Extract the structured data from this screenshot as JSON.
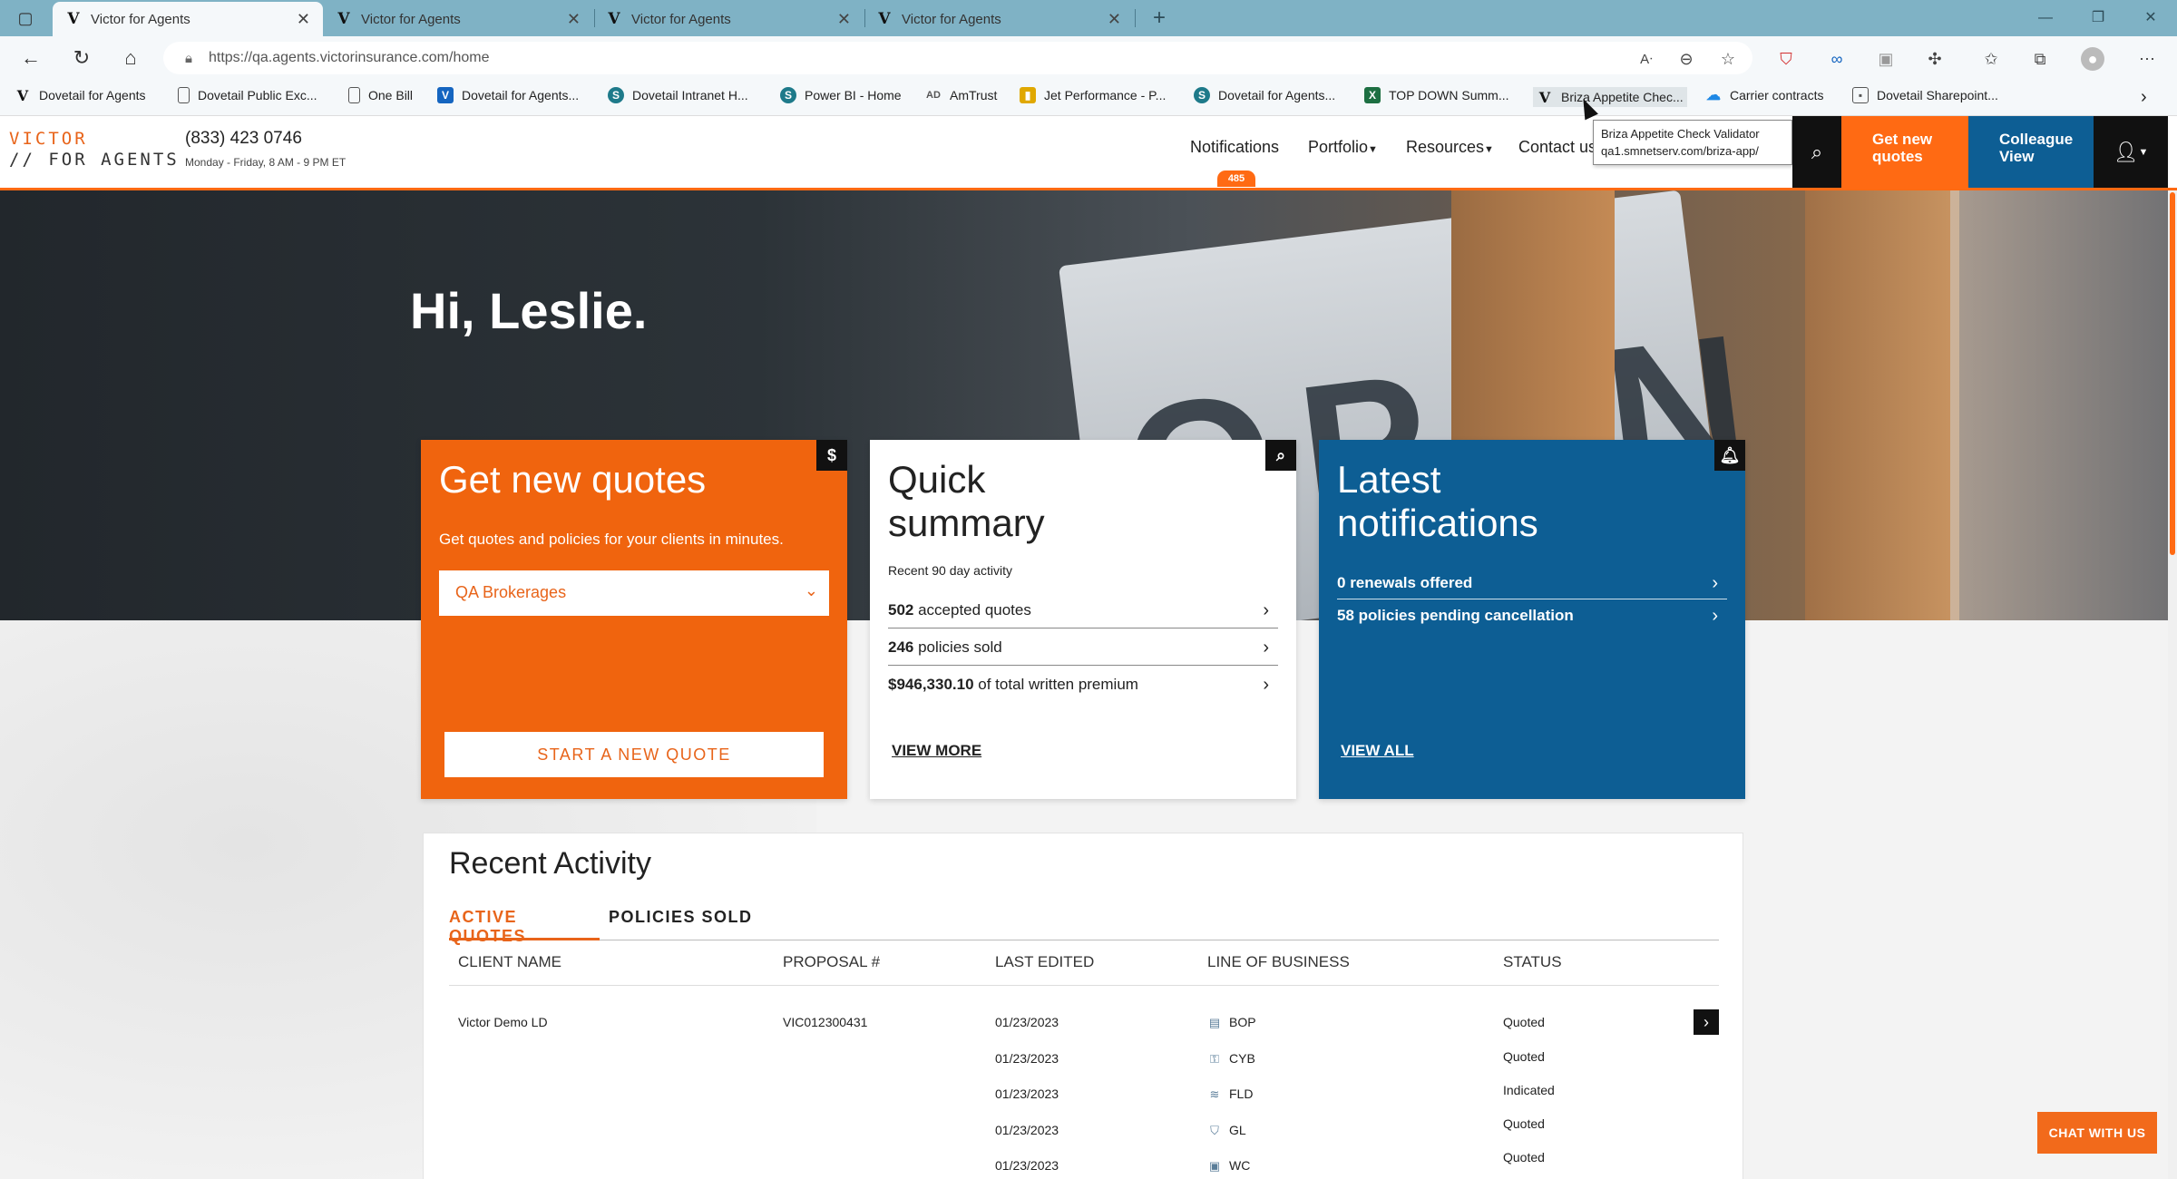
{
  "browser": {
    "tabs": [
      {
        "title": "Victor for Agents",
        "active": true
      },
      {
        "title": "Victor for Agents",
        "active": false
      },
      {
        "title": "Victor for Agents",
        "active": false
      },
      {
        "title": "Victor for Agents",
        "active": false
      }
    ],
    "url": "https://qa.agents.victorinsurance.com/home",
    "bookmarks": [
      {
        "label": "Dovetail for Agents",
        "icon": "victor-icon",
        "color": "#111111"
      },
      {
        "label": "Dovetail Public Exc...",
        "icon": "page-icon",
        "color": "#555555"
      },
      {
        "label": "One Bill",
        "icon": "page-icon",
        "color": "#555555"
      },
      {
        "label": "Dovetail for Agents...",
        "icon": "shield-v-icon",
        "color": "#1565c0"
      },
      {
        "label": "Dovetail Intranet H...",
        "icon": "sharepoint-icon",
        "color": "#1e7a8a"
      },
      {
        "label": "Power BI - Home",
        "icon": "sharepoint-icon",
        "color": "#1e7a8a"
      },
      {
        "label": "AmTrust",
        "icon": "amtrust-icon",
        "color": "#555555"
      },
      {
        "label": "Jet Performance - P...",
        "icon": "chart-icon",
        "color": "#e0a800"
      },
      {
        "label": "Dovetail for Agents...",
        "icon": "sharepoint-icon",
        "color": "#1e7a8a"
      },
      {
        "label": "TOP DOWN Summ...",
        "icon": "excel-icon",
        "color": "#1d6f42"
      },
      {
        "label": "Briza Appetite Chec...",
        "icon": "victor-icon",
        "color": "#111111"
      },
      {
        "label": "Carrier contracts",
        "icon": "cloud-icon",
        "color": "#1e88e5"
      },
      {
        "label": "Dovetail Sharepoint...",
        "icon": "image-icon",
        "color": "#555555"
      }
    ],
    "tooltip": {
      "title": "Briza Appetite Check Validator",
      "url": "qa1.smnetserv.com/briza-app/"
    }
  },
  "header": {
    "logo_line1": "VICTOR",
    "logo_line2": "// FOR AGENTS",
    "phone": "(833) 423 0746",
    "hours": "Monday - Friday, 8 AM - 9 PM ET",
    "nav": {
      "notifications": "Notifications",
      "notifications_count": "485",
      "portfolio": "Portfolio",
      "resources": "Resources",
      "contact": "Contact us"
    },
    "get_quotes_line1": "Get new",
    "get_quotes_line2": "quotes",
    "colleague_line1": "Colleague",
    "colleague_line2": "View"
  },
  "hero": {
    "greeting": "Hi, Leslie.",
    "sign_text": "OPEN"
  },
  "cards": {
    "quotes": {
      "title": "Get new quotes",
      "subtitle": "Get quotes and policies for your clients in minutes.",
      "select_value": "QA Brokerages",
      "button": "START A NEW QUOTE"
    },
    "summary": {
      "title_line1": "Quick",
      "title_line2": "summary",
      "subtitle": "Recent 90 day activity",
      "rows": [
        {
          "value": "502",
          "label": " accepted quotes"
        },
        {
          "value": "246",
          "label": " policies sold"
        },
        {
          "value": "$946,330.10",
          "label": " of total written premium"
        }
      ],
      "link": "VIEW MORE"
    },
    "notifications": {
      "title_line1": "Latest",
      "title_line2": "notifications",
      "rows": [
        {
          "value": "0",
          "label": " renewals offered"
        },
        {
          "value": "58",
          "label": " policies pending cancellation"
        }
      ],
      "link": "VIEW ALL"
    }
  },
  "activity": {
    "title": "Recent Activity",
    "tabs": [
      "ACTIVE QUOTES",
      "POLICIES SOLD"
    ],
    "columns": [
      "CLIENT NAME",
      "PROPOSAL #",
      "LAST EDITED",
      "LINE OF BUSINESS",
      "STATUS"
    ],
    "client": "Victor Demo LD",
    "proposal": "VIC012300431",
    "rows": [
      {
        "date": "01/23/2023",
        "lob": "BOP",
        "lob_icon": "document-icon",
        "status": "Quoted"
      },
      {
        "date": "01/23/2023",
        "lob": "CYB",
        "lob_icon": "cyber-icon",
        "status": "Quoted"
      },
      {
        "date": "01/23/2023",
        "lob": "FLD",
        "lob_icon": "flood-icon",
        "status": "Indicated"
      },
      {
        "date": "01/23/2023",
        "lob": "GL",
        "lob_icon": "shield-icon",
        "status": "Quoted"
      },
      {
        "date": "01/23/2023",
        "lob": "WC",
        "lob_icon": "briefcase-icon",
        "status": "Quoted"
      }
    ]
  },
  "chat_button": "CHAT WITH US",
  "colors": {
    "accent": "#ff6a13",
    "brand_blue": "#0d5e94"
  }
}
